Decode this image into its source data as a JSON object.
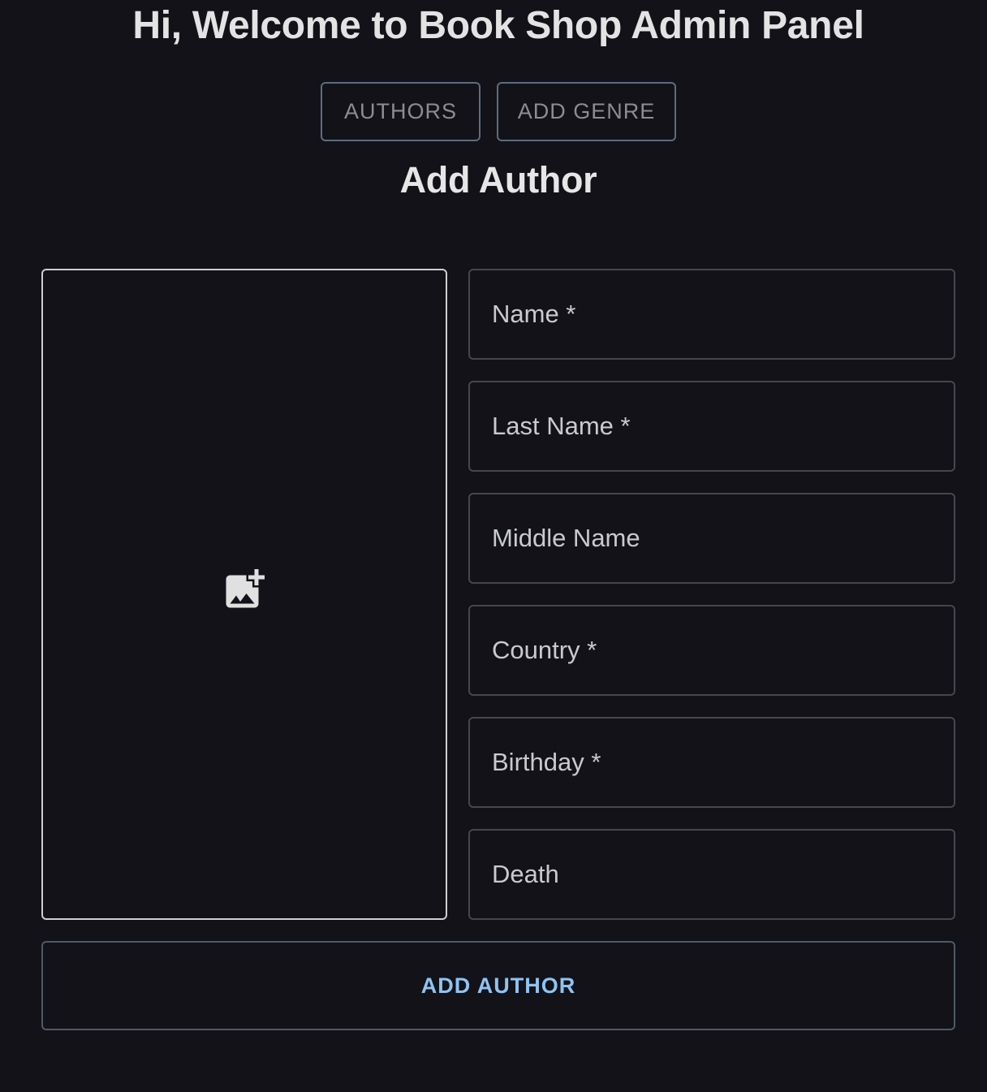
{
  "header": {
    "welcome": "Hi, Welcome to Book Shop Admin Panel"
  },
  "nav": {
    "authors_label": "AUTHORS",
    "add_genre_label": "ADD GENRE"
  },
  "form": {
    "title": "Add Author",
    "image_upload_icon": "add-photo-icon",
    "fields": [
      {
        "label": "Name *",
        "value": ""
      },
      {
        "label": "Last Name *",
        "value": ""
      },
      {
        "label": "Middle Name",
        "value": ""
      },
      {
        "label": "Country *",
        "value": ""
      },
      {
        "label": "Birthday *",
        "value": ""
      },
      {
        "label": "Death",
        "value": ""
      }
    ],
    "submit_label": "ADD AUTHOR"
  },
  "colors": {
    "background": "#121218",
    "accent": "#90c3f2",
    "text": "#e3e3e3"
  }
}
